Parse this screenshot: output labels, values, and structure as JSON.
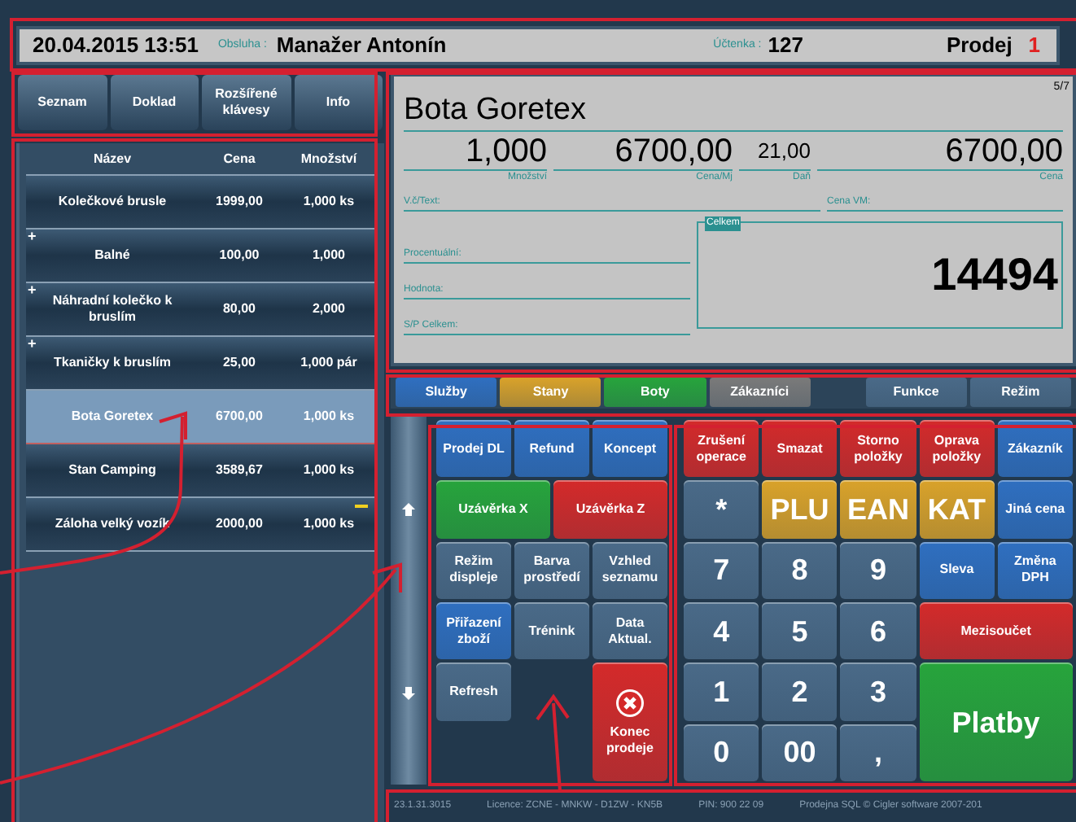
{
  "header": {
    "datetime": "20.04.2015 13:51",
    "operator_label": "Obsluha :",
    "operator": "Manažer Antonín",
    "receipt_label": "Účtenka :",
    "receipt": "127",
    "mode": "Prodej",
    "counter": "1"
  },
  "top_buttons": [
    "Seznam",
    "Doklad",
    "Rozšířené klávesy",
    "Info"
  ],
  "list": {
    "columns": [
      "Název",
      "Cena",
      "Množství"
    ],
    "rows": [
      {
        "name": "Kolečkové brusle",
        "price": "1999,00",
        "qty": "1,000 ks",
        "marker": "",
        "selected": false,
        "flagged": false
      },
      {
        "name": "Balné",
        "price": "100,00",
        "qty": "1,000",
        "marker": "+",
        "selected": false,
        "flagged": false
      },
      {
        "name": "Náhradní kolečko k bruslím",
        "price": "80,00",
        "qty": "2,000",
        "marker": "+",
        "selected": false,
        "flagged": false
      },
      {
        "name": "Tkaničky k bruslím",
        "price": "25,00",
        "qty": "1,000 pár",
        "marker": "+",
        "selected": false,
        "flagged": false
      },
      {
        "name": "Bota Goretex",
        "price": "6700,00",
        "qty": "1,000 ks",
        "marker": "",
        "selected": true,
        "flagged": false
      },
      {
        "name": "Stan Camping",
        "price": "3589,67",
        "qty": "1,000 ks",
        "marker": "",
        "selected": false,
        "flagged": false
      },
      {
        "name": "Záloha velký vozík",
        "price": "2000,00",
        "qty": "1,000 ks",
        "marker": "",
        "selected": false,
        "flagged": true
      }
    ]
  },
  "detail": {
    "position": "5/7",
    "item": "Bota Goretex",
    "values": [
      {
        "value": "1,000",
        "caption": "Množství"
      },
      {
        "value": "6700,00",
        "caption": "Cena/Mj"
      },
      {
        "value": "21,00",
        "caption": "Daň"
      },
      {
        "value": "6700,00",
        "caption": "Cena"
      }
    ],
    "text_label": "V.č/Text:",
    "vm_label": "Cena VM:",
    "fields": [
      "Procentuální:",
      "Hodnota:",
      "S/P Celkem:"
    ],
    "total_label": "Celkem",
    "total": "14494"
  },
  "tabs": [
    {
      "label": "Služby",
      "color": "#2f6fc0"
    },
    {
      "label": "Stany",
      "color": "#d9a22a"
    },
    {
      "label": "Boty",
      "color": "#27a43c"
    },
    {
      "label": "Zákazníci",
      "color": "#7a7a7a"
    },
    {
      "label": "Funkce",
      "color": "#4a6a88"
    },
    {
      "label": "Režim",
      "color": "#4a6a88"
    }
  ],
  "function_keys": [
    {
      "label": "Prodej DL",
      "color": "#2f6fc0"
    },
    {
      "label": "Refund",
      "color": "#2f6fc0"
    },
    {
      "label": "Koncept",
      "color": "#2f6fc0"
    },
    {
      "label": "Uzávěrka X",
      "color": "#27a43c"
    },
    {
      "label": "Uzávěrka Z",
      "color": "#d42a2a"
    },
    {
      "label": "Režim displeje",
      "color": "#4a6a88"
    },
    {
      "label": "Barva prostředí",
      "color": "#4a6a88"
    },
    {
      "label": "Vzhled seznamu",
      "color": "#4a6a88"
    },
    {
      "label": "Přiřazení zboží",
      "color": "#2f6fc0"
    },
    {
      "label": "Trénink",
      "color": "#4a6a88"
    },
    {
      "label": "Data Aktual.",
      "color": "#4a6a88"
    },
    {
      "label": "Refresh",
      "color": "#4a6a88"
    },
    {
      "label": "Konec prodeje",
      "color": "#d42a2a"
    }
  ],
  "numpad": [
    {
      "label": "Zrušení operace",
      "color": "#d42a2a"
    },
    {
      "label": "Smazat",
      "color": "#d42a2a"
    },
    {
      "label": "Storno položky",
      "color": "#d42a2a"
    },
    {
      "label": "Oprava položky",
      "color": "#d42a2a"
    },
    {
      "label": "Zákazník",
      "color": "#2f6fc0"
    },
    {
      "label": "*",
      "color": "#4a6a88"
    },
    {
      "label": "PLU",
      "color": "#d9a22a"
    },
    {
      "label": "EAN",
      "color": "#d9a22a"
    },
    {
      "label": "KAT",
      "color": "#d9a22a"
    },
    {
      "label": "Jiná cena",
      "color": "#2f6fc0"
    },
    {
      "label": "7",
      "color": "#4a6a88"
    },
    {
      "label": "8",
      "color": "#4a6a88"
    },
    {
      "label": "9",
      "color": "#4a6a88"
    },
    {
      "label": "Sleva",
      "color": "#2f6fc0"
    },
    {
      "label": "Změna DPH",
      "color": "#2f6fc0"
    },
    {
      "label": "4",
      "color": "#4a6a88"
    },
    {
      "label": "5",
      "color": "#4a6a88"
    },
    {
      "label": "6",
      "color": "#4a6a88"
    },
    {
      "label": "Mezisoučet",
      "color": "#d42a2a"
    },
    {
      "label": "1",
      "color": "#4a6a88"
    },
    {
      "label": "2",
      "color": "#4a6a88"
    },
    {
      "label": "3",
      "color": "#4a6a88"
    },
    {
      "label": "Platby",
      "color": "#27a43c"
    },
    {
      "label": "0",
      "color": "#4a6a88"
    },
    {
      "label": "00",
      "color": "#4a6a88"
    },
    {
      "label": ",",
      "color": "#4a6a88"
    }
  ],
  "status_bar": [
    "23.1.31.3015",
    "Licence: ZCNE - MNKW - D1ZW - KN5B",
    "PIN: 900 22 09",
    "Prodejna SQL © Cigler software 2007-201"
  ]
}
